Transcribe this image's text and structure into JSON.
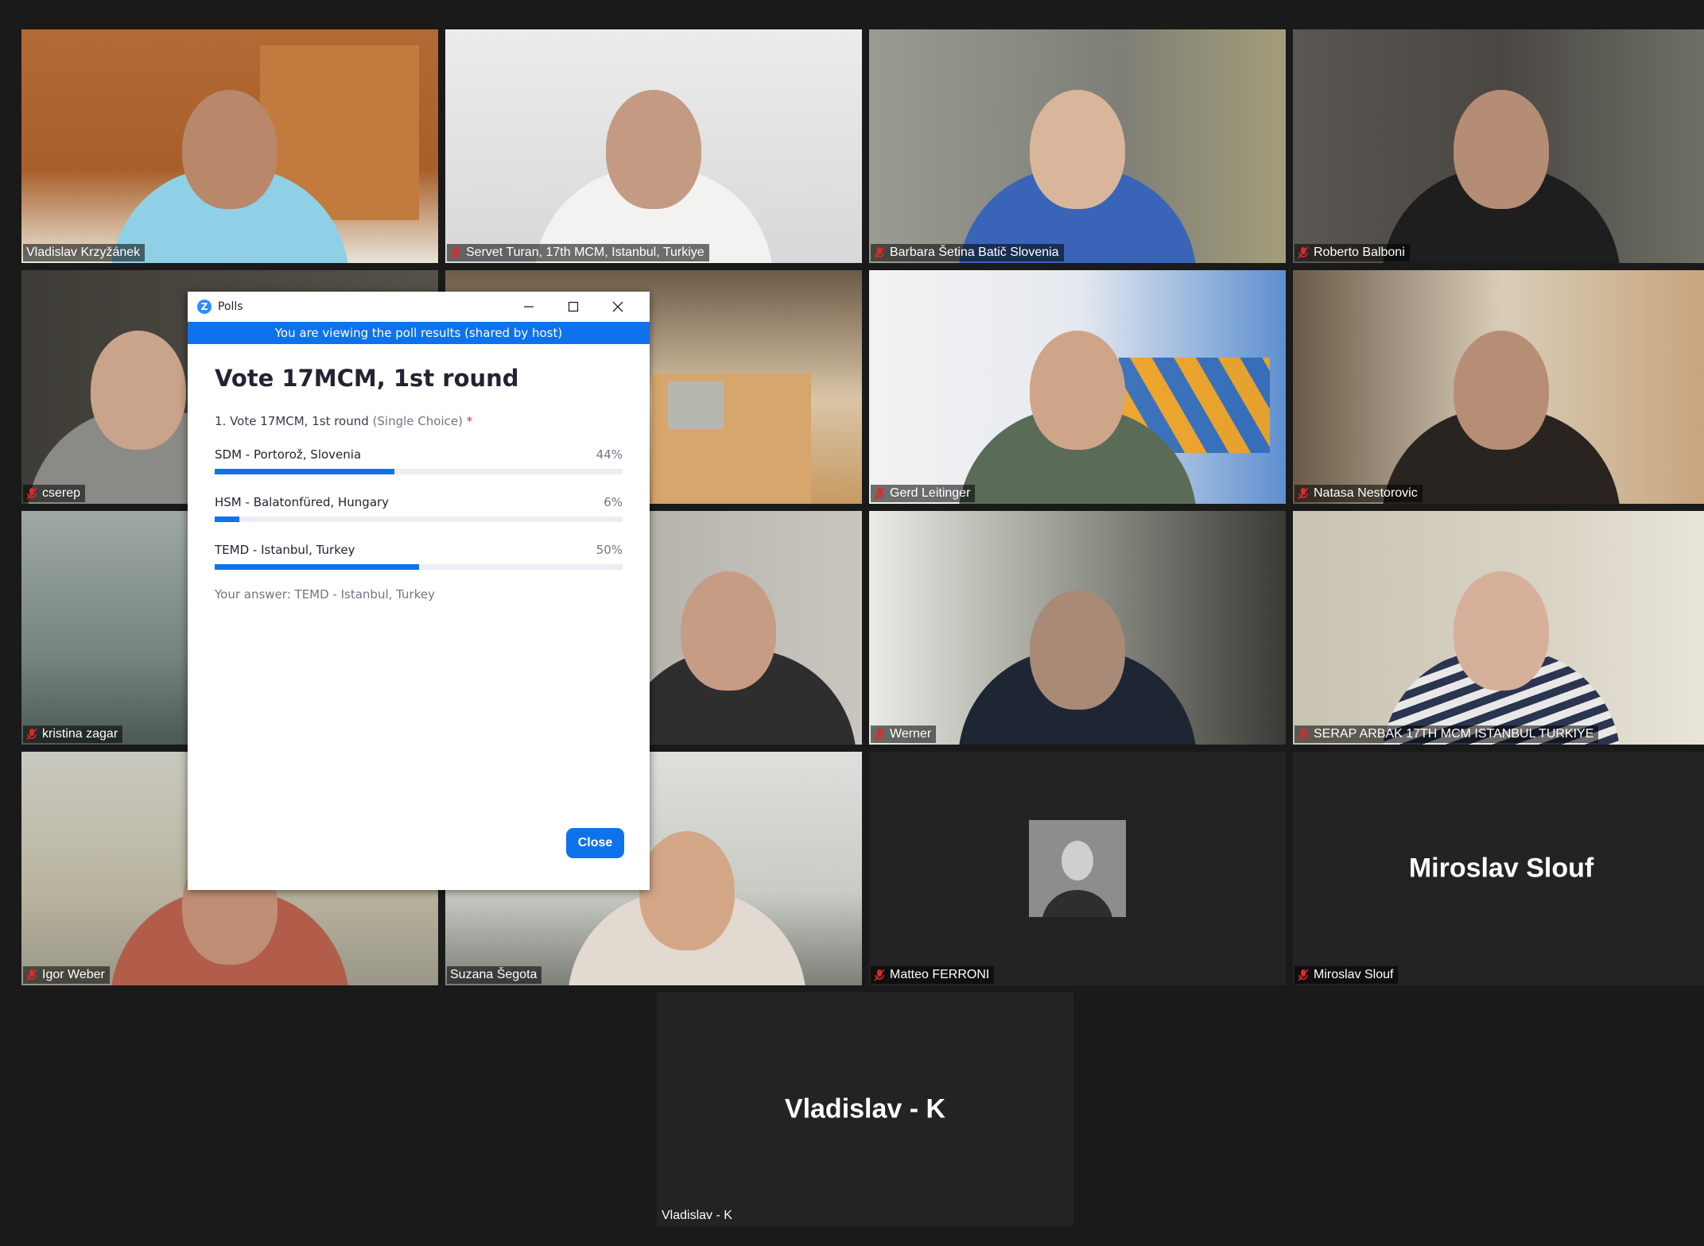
{
  "participants": [
    {
      "name": "Vladislav Krzyžánek",
      "muted": false
    },
    {
      "name": "Servet Turan, 17th MCM, Istanbul, Turkiye",
      "muted": true
    },
    {
      "name": "Barbara Šetina Batič Slovenia",
      "muted": true
    },
    {
      "name": "Roberto Balboni",
      "muted": true
    },
    {
      "name": "cserep",
      "muted": true
    },
    {
      "name": "Gerd Leitinger",
      "muted": true
    },
    {
      "name": "Natasa Nestorovic",
      "muted": true
    },
    {
      "name": "kristina zagar",
      "muted": true
    },
    {
      "name": "Werner",
      "muted": true
    },
    {
      "name": "SERAP ARBAK 17TH MCM ISTANBUL TURKIYE",
      "muted": true
    },
    {
      "name": "Igor Weber",
      "muted": true
    },
    {
      "name": "Suzana Šegota",
      "muted": false
    },
    {
      "name": "Matteo FERRONI",
      "muted": true
    },
    {
      "name": "Miroslav Slouf",
      "muted": true,
      "display_name": "Miroslav Slouf"
    },
    {
      "name": "Vladislav - K",
      "muted": false,
      "display_name": "Vladislav - K"
    }
  ],
  "poll": {
    "window_title": "Polls",
    "banner": "You are viewing the poll results (shared by host)",
    "title": "Vote 17MCM, 1st round",
    "question_text": "1. Vote 17MCM, 1st round",
    "question_type": "(Single Choice)",
    "required_mark": "*",
    "options": [
      {
        "label": "SDM - Portorož, Slovenia",
        "percent_label": "44%",
        "percent": 44
      },
      {
        "label": "HSM - Balatonfüred, Hungary",
        "percent_label": "6%",
        "percent": 6
      },
      {
        "label": "TEMD - Istanbul, Turkey",
        "percent_label": "50%",
        "percent": 50
      }
    ],
    "your_answer": "Your answer: TEMD - Istanbul, Turkey",
    "close_label": "Close"
  }
}
